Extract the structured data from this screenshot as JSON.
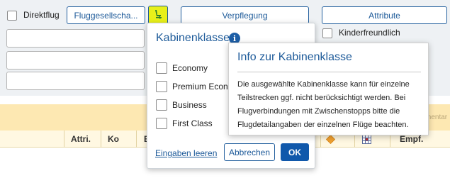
{
  "filters": {
    "direct_flight_label": "Direktflug",
    "airlines_button": "Fluggesellscha...",
    "meals_button": "Verpflegung",
    "attributes_button": "Attribute",
    "family_friendly_label": "Kinderfreundlich",
    "cut_text_right": "mentar"
  },
  "table": {
    "headers": [
      "Attri.",
      "Ko",
      "E",
      "Empf."
    ]
  },
  "cabin_popup": {
    "title": "Kabinenklasse",
    "info_glyph": "i",
    "options": [
      {
        "label": "Economy",
        "checked": false
      },
      {
        "label": "Premium Econo",
        "checked": false
      },
      {
        "label": "Business",
        "checked": false
      },
      {
        "label": "First Class",
        "checked": false
      }
    ],
    "clear_link": "Eingaben leeren",
    "cancel_button": "Abbrechen",
    "ok_button": "OK"
  },
  "tooltip": {
    "title": "Info zur Kabinenklasse",
    "body": "Die ausgewählte Kabinenklasse kann für einzelne Teilstrecken ggf. nicht berücksichtigt werden. Bei Flugverbindungen mit Zwischenstopps bitte die Flugdetailangaben der einzelnen Flüge beachten."
  },
  "colors": {
    "accent": "#1d5a99",
    "ok_button": "#1058ab",
    "seat_icon_bg": "#e8f01a",
    "orange_band": "#fde8b2",
    "diamond": "#f0a030"
  },
  "icons": {
    "seat": "seat-icon",
    "info": "info-icon",
    "diamond": "diamond-icon",
    "grid": "grid-icon"
  }
}
